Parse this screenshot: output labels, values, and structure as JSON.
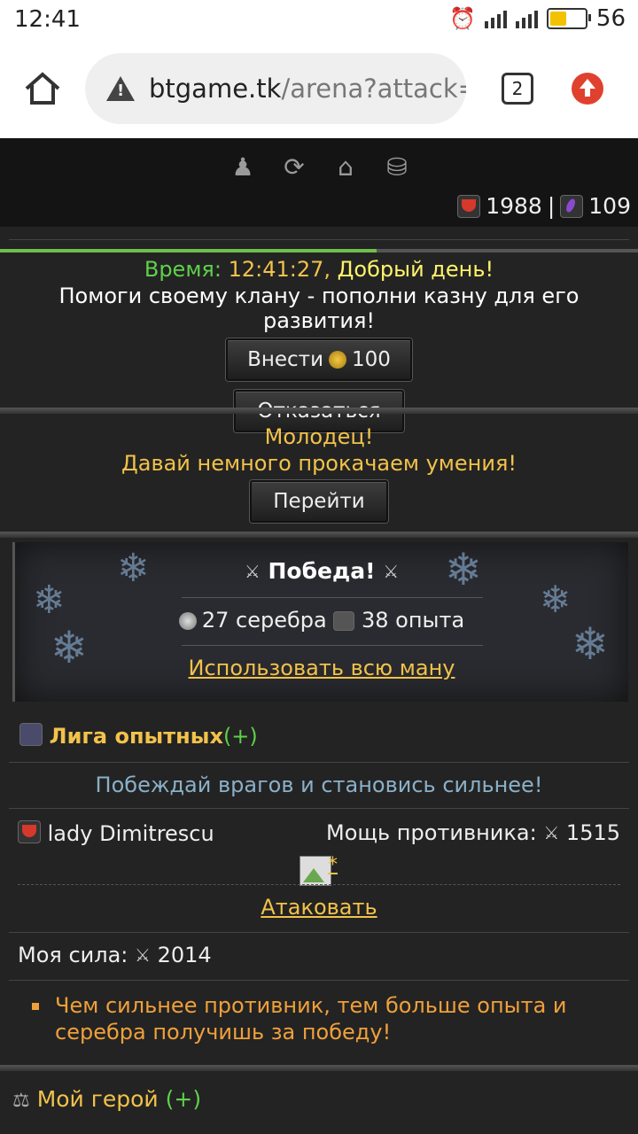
{
  "status_bar": {
    "time": "12:41",
    "battery": "56"
  },
  "browser": {
    "url_host": "btgame.tk",
    "url_path": "/arena?attack=",
    "tab_count": "2"
  },
  "header": {
    "stat1_value": "1988",
    "stat_sep": "|",
    "stat2_value": "109",
    "nav_icons": [
      "profile-icon",
      "refresh-icon",
      "home-icon",
      "coins-icon"
    ]
  },
  "progress": {
    "fraction": 0.59
  },
  "clan": {
    "time_label": "Время:",
    "time_value": "12:41:27,",
    "greeting": "Добрый день!",
    "message": "Помоги своему клану - пополни казну для его развития!",
    "donate_label": "Внести",
    "donate_amount": "100",
    "refuse_label": "Отказаться"
  },
  "skills": {
    "line1": "Молодец!",
    "line2": "Давай немного прокачаем умения!",
    "go_label": "Перейти"
  },
  "victory": {
    "title": "Победа!",
    "silver": "27 серебра",
    "exp": "38 опыта",
    "use_mana": "Использовать всю ману"
  },
  "league": {
    "name": "Лига опытных",
    "plus": "(+)",
    "hint": "Побеждай врагов и становись сильнее!",
    "enemy_name": "lady Dimitrescu",
    "enemy_power_label": "Мощь противника:",
    "enemy_power": "1515",
    "img_link": "*",
    "attack_label": "Атаковать",
    "my_power_label": "Моя сила:",
    "my_power": "2014",
    "tip": "Чем сильнее противник, тем больше опыта и серебра получишь за победу!"
  },
  "hero": {
    "label": "Мой герой",
    "plus": "(+)"
  }
}
